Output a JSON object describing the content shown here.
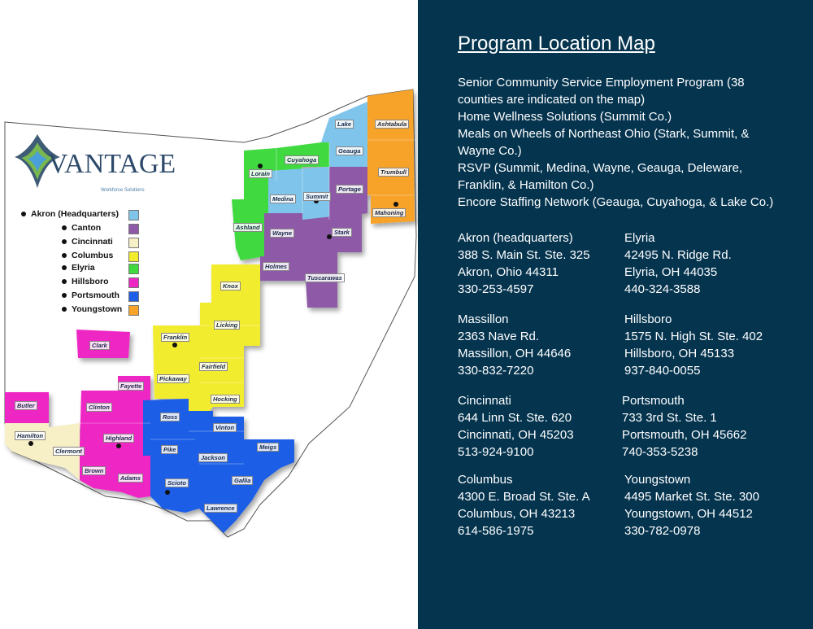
{
  "title": "Program Location Map",
  "programs": [
    "Senior Community Service Employment Program (38 counties are indicated on the map)",
    "Home Wellness Solutions (Summit Co.)",
    "Meals on Wheels of Northeast Ohio (Stark, Summit, & Wayne Co.)",
    "RSVP (Summit, Medina, Wayne, Geauga, Deleware, Franklin, & Hamilton Co.)",
    "Encore Staffing Network (Geauga, Cuyahoga, & Lake Co.)"
  ],
  "offices": [
    {
      "name": "Akron (headquarters)",
      "street": "388 S. Main St. Ste. 325",
      "city": "Akron, Ohio 44311",
      "phone": "330-253-4597"
    },
    {
      "name": "Elyria",
      "street": "42495 N. Ridge Rd.",
      "city": "Elyria, OH 44035",
      "phone": "440-324-3588"
    },
    {
      "name": "Massillon",
      "street": "2363 Nave Rd.",
      "city": "Massillon, OH 44646",
      "phone": "330-832-7220"
    },
    {
      "name": "Hillsboro",
      "street": "1575 N. High St. Ste. 402",
      "city": "Hillsboro, OH 45133",
      "phone": "937-840-0055"
    },
    {
      "name": "Cincinnati",
      "street": "644 Linn St. Ste. 620",
      "city": "Cincinnati, OH 45203",
      "phone": "513-924-9100"
    },
    {
      "name": "Portsmouth",
      "street": "733 3rd St. Ste. 1",
      "city": "Portsmouth, OH 45662",
      "phone": "740-353-5238"
    },
    {
      "name": "Columbus",
      "street": "4300 E. Broad St. Ste. A",
      "city": "Columbus, OH 43213",
      "phone": "614-586-1975"
    },
    {
      "name": "Youngstown",
      "street": "4495 Market St. Ste. 300",
      "city": "Youngstown, OH 44512",
      "phone": "330-782-0978"
    }
  ],
  "logo": {
    "brand": "VANTAGE",
    "tagline": "Workforce Solutions"
  },
  "legend": [
    {
      "label": "Akron (Headquarters)",
      "color": "#7fc4ea"
    },
    {
      "label": "Canton",
      "color": "#8e5aa8"
    },
    {
      "label": "Cincinnati",
      "color": "#f7efc6"
    },
    {
      "label": "Columbus",
      "color": "#f2ec2d"
    },
    {
      "label": "Elyria",
      "color": "#3fd93f"
    },
    {
      "label": "Hillsboro",
      "color": "#ee27c4"
    },
    {
      "label": "Portsmouth",
      "color": "#1e5ee6"
    },
    {
      "label": "Youngstown",
      "color": "#f7a32a"
    }
  ],
  "counties": [
    {
      "name": "Lake",
      "region": "Akron (Headquarters)"
    },
    {
      "name": "Ashtabula",
      "region": "Youngstown"
    },
    {
      "name": "Cuyahoga",
      "region": "Elyria"
    },
    {
      "name": "Geauga",
      "region": "Akron (Headquarters)"
    },
    {
      "name": "Lorain",
      "region": "Elyria"
    },
    {
      "name": "Trumbull",
      "region": "Youngstown"
    },
    {
      "name": "Medina",
      "region": "Akron (Headquarters)"
    },
    {
      "name": "Summit",
      "region": "Akron (Headquarters)"
    },
    {
      "name": "Portage",
      "region": "Canton"
    },
    {
      "name": "Mahoning",
      "region": "Youngstown"
    },
    {
      "name": "Ashland",
      "region": "Elyria"
    },
    {
      "name": "Wayne",
      "region": "Canton"
    },
    {
      "name": "Stark",
      "region": "Canton"
    },
    {
      "name": "Holmes",
      "region": "Canton"
    },
    {
      "name": "Tuscarawas",
      "region": "Canton"
    },
    {
      "name": "Knox",
      "region": "Columbus"
    },
    {
      "name": "Licking",
      "region": "Columbus"
    },
    {
      "name": "Franklin",
      "region": "Columbus"
    },
    {
      "name": "Clark",
      "region": "Hillsboro"
    },
    {
      "name": "Fairfield",
      "region": "Columbus"
    },
    {
      "name": "Pickaway",
      "region": "Columbus"
    },
    {
      "name": "Fayette",
      "region": "Hillsboro"
    },
    {
      "name": "Hocking",
      "region": "Columbus"
    },
    {
      "name": "Butler",
      "region": "Hillsboro"
    },
    {
      "name": "Clinton",
      "region": "Hillsboro"
    },
    {
      "name": "Ross",
      "region": "Portsmouth"
    },
    {
      "name": "Vinton",
      "region": "Portsmouth"
    },
    {
      "name": "Hamilton",
      "region": "Cincinnati"
    },
    {
      "name": "Highland",
      "region": "Hillsboro"
    },
    {
      "name": "Clermont",
      "region": "Cincinnati"
    },
    {
      "name": "Pike",
      "region": "Portsmouth"
    },
    {
      "name": "Meigs",
      "region": "Portsmouth"
    },
    {
      "name": "Jackson",
      "region": "Portsmouth"
    },
    {
      "name": "Brown",
      "region": "Hillsboro"
    },
    {
      "name": "Adams",
      "region": "Hillsboro"
    },
    {
      "name": "Scioto",
      "region": "Portsmouth"
    },
    {
      "name": "Gallia",
      "region": "Portsmouth"
    },
    {
      "name": "Lawrence",
      "region": "Portsmouth"
    }
  ]
}
